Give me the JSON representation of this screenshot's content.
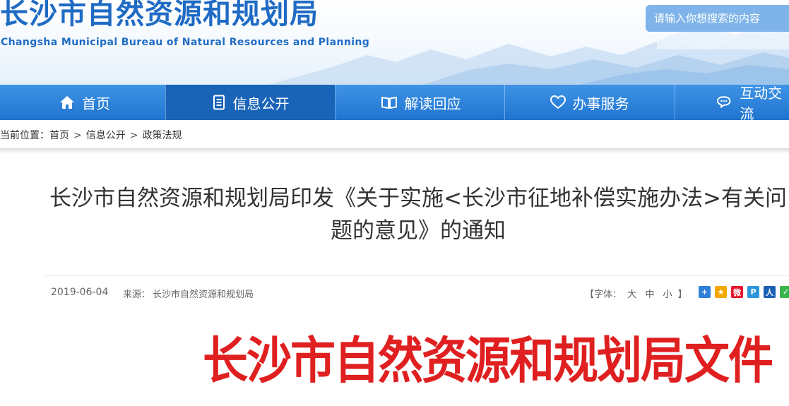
{
  "header": {
    "title": "长沙市自然资源和规划局",
    "subtitle": "Changsha Municipal Bureau of Natural Resources and Planning",
    "search_placeholder": "请输入你想搜索的内容"
  },
  "nav": {
    "items": [
      {
        "label": "首页",
        "icon": "home-icon"
      },
      {
        "label": "信息公开",
        "icon": "document-list-icon"
      },
      {
        "label": "解读回应",
        "icon": "open-book-icon"
      },
      {
        "label": "办事服务",
        "icon": "heart-icon"
      },
      {
        "label": "互动交流",
        "icon": "chat-bubble-icon"
      }
    ],
    "active_index": 1
  },
  "breadcrumb": {
    "prefix": "当前位置：",
    "items": [
      "首页",
      "信息公开",
      "政策法规"
    ],
    "separator": ">"
  },
  "article": {
    "title": "长沙市自然资源和规划局印发《关于实施<长沙市征地补偿实施办法>有关问题的意见》的通知",
    "date": "2019-06-04",
    "source_label": "来源：",
    "source": "长沙市自然资源和规划局",
    "font_size": {
      "open": "【字体：",
      "large": "大",
      "medium": "中",
      "small": "小",
      "close": "】"
    },
    "document_header": "长沙市自然资源和规划局文件"
  },
  "share_icons": [
    {
      "icon": "share-more-icon",
      "glyph": "+",
      "color": "#2f7fd6"
    },
    {
      "icon": "qzone-icon",
      "glyph": "★",
      "color": "#f2a900"
    },
    {
      "icon": "weibo-icon",
      "glyph": "微",
      "color": "#e6162d"
    },
    {
      "icon": "tencent-weibo-icon",
      "glyph": "P",
      "color": "#2b96d8"
    },
    {
      "icon": "renren-icon",
      "glyph": "人",
      "color": "#1a5fb4"
    },
    {
      "icon": "wechat-icon",
      "glyph": "✓",
      "color": "#3bb54a"
    }
  ],
  "colors": {
    "brand_blue": "#1f6bc4",
    "nav_blue": "#2a80d8",
    "nav_active": "#1a64b8",
    "document_red": "#e02020"
  }
}
